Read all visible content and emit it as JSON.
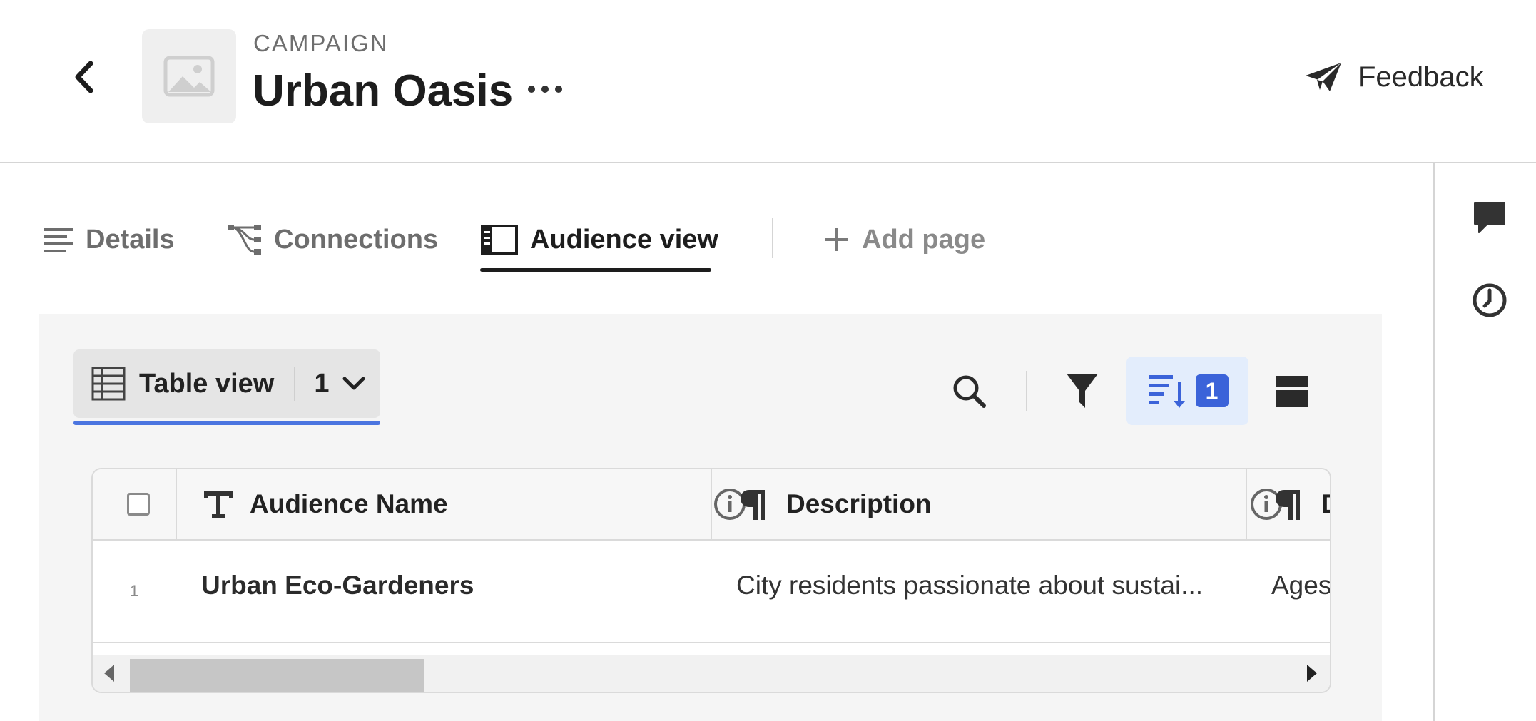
{
  "header": {
    "kicker": "CAMPAIGN",
    "title": "Urban Oasis",
    "feedback_label": "Feedback"
  },
  "tabs": [
    {
      "label": "Details",
      "icon": "details-icon"
    },
    {
      "label": "Connections",
      "icon": "connections-icon"
    },
    {
      "label": "Audience view",
      "icon": "audience-view-icon",
      "active": true
    },
    {
      "label": "Add page",
      "icon": "plus-icon"
    }
  ],
  "view": {
    "label": "Table view",
    "count": "1"
  },
  "toolbar": {
    "sort_count": "1"
  },
  "table": {
    "columns": [
      {
        "label": "Audience Name",
        "type_icon": "text-type-icon"
      },
      {
        "label": "Description",
        "type_icon": "paragraph-icon"
      },
      {
        "label": "D",
        "type_icon": "paragraph-icon"
      }
    ],
    "rows": [
      {
        "num": "1",
        "name": "Urban Eco-Gardeners",
        "description": "City residents passionate about sustai...",
        "third": "Ages"
      }
    ]
  },
  "colors": {
    "accent": "#4b75e0",
    "badge": "#3b63d9",
    "panel_bg": "#f5f5f5"
  }
}
